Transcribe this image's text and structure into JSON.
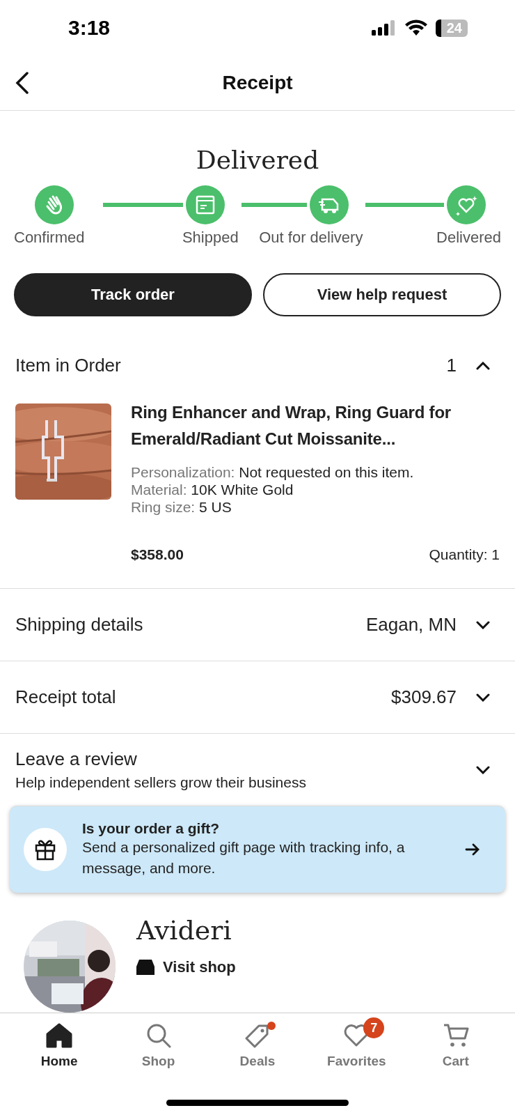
{
  "status_bar": {
    "time": "3:18",
    "battery": "24"
  },
  "header": {
    "title": "Receipt"
  },
  "order_status": {
    "title": "Delivered",
    "steps": [
      {
        "label": "Confirmed",
        "kind": "hand",
        "done": true
      },
      {
        "label": "Shipped",
        "kind": "box",
        "done": true
      },
      {
        "label": "Out for delivery",
        "kind": "truck",
        "done": true
      },
      {
        "label": "Delivered",
        "kind": "heart",
        "done": true
      }
    ]
  },
  "actions": [
    {
      "label": "Track order",
      "kind": "primary"
    },
    {
      "label": "View help request",
      "kind": "secondary"
    }
  ],
  "items_section": {
    "title": "Item in Order",
    "count": "1",
    "expanded": true,
    "item": {
      "title": "Ring Enhancer and Wrap, Ring Guard for Emerald/Radiant Cut Moissanite...",
      "details": [
        {
          "label": "Personalization:",
          "value": "Not requested on this item."
        },
        {
          "label": "Material:",
          "value": "10K White Gold"
        },
        {
          "label": "Ring size:",
          "value": "5 US"
        }
      ],
      "price": "$358.00",
      "quantity": "Quantity: 1"
    }
  },
  "sections": [
    {
      "title": "Shipping details",
      "value": "Eagan, MN",
      "expanded": false
    },
    {
      "title": "Receipt total",
      "value": "$309.67",
      "expanded": false
    },
    {
      "title": "Leave a review",
      "subtitle": "Help independent sellers grow their business",
      "expanded": false
    }
  ],
  "gift_banner": {
    "title": "Is your order a gift?",
    "text": "Send a personalized gift page with tracking info, a message, and more."
  },
  "shop": {
    "name": "Avideri",
    "link": "Visit shop"
  },
  "tab_bar": [
    {
      "label": "Home",
      "kind": "home",
      "selected": true
    },
    {
      "label": "Shop",
      "kind": "search",
      "selected": false
    },
    {
      "label": "Deals",
      "kind": "tag",
      "selected": false,
      "dot": true
    },
    {
      "label": "Favorites",
      "kind": "heart",
      "selected": false,
      "badge": "7"
    },
    {
      "label": "Cart",
      "kind": "cart",
      "selected": false
    }
  ]
}
